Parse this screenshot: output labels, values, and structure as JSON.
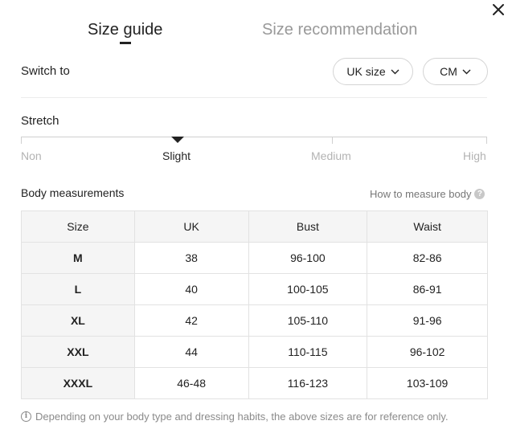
{
  "tabs": {
    "active": "Size guide",
    "inactive": "Size recommendation"
  },
  "switch": {
    "label": "Switch to",
    "size_system": "UK size",
    "unit": "CM"
  },
  "stretch": {
    "title": "Stretch",
    "levels": [
      "Non",
      "Slight",
      "Medium",
      "High"
    ],
    "selected": "Slight"
  },
  "body": {
    "title": "Body measurements",
    "how_to": "How to measure body"
  },
  "table": {
    "headers": [
      "Size",
      "UK",
      "Bust",
      "Waist"
    ],
    "rows": [
      [
        "M",
        "38",
        "96-100",
        "82-86"
      ],
      [
        "L",
        "40",
        "100-105",
        "86-91"
      ],
      [
        "XL",
        "42",
        "105-110",
        "91-96"
      ],
      [
        "XXL",
        "44",
        "110-115",
        "96-102"
      ],
      [
        "XXXL",
        "46-48",
        "116-123",
        "103-109"
      ]
    ]
  },
  "note": "Depending on your body type and dressing habits, the above sizes are for reference only.",
  "icons": {
    "close": "close-icon",
    "chevron": "chevron-down-icon",
    "help": "question-icon",
    "info": "info-icon"
  }
}
